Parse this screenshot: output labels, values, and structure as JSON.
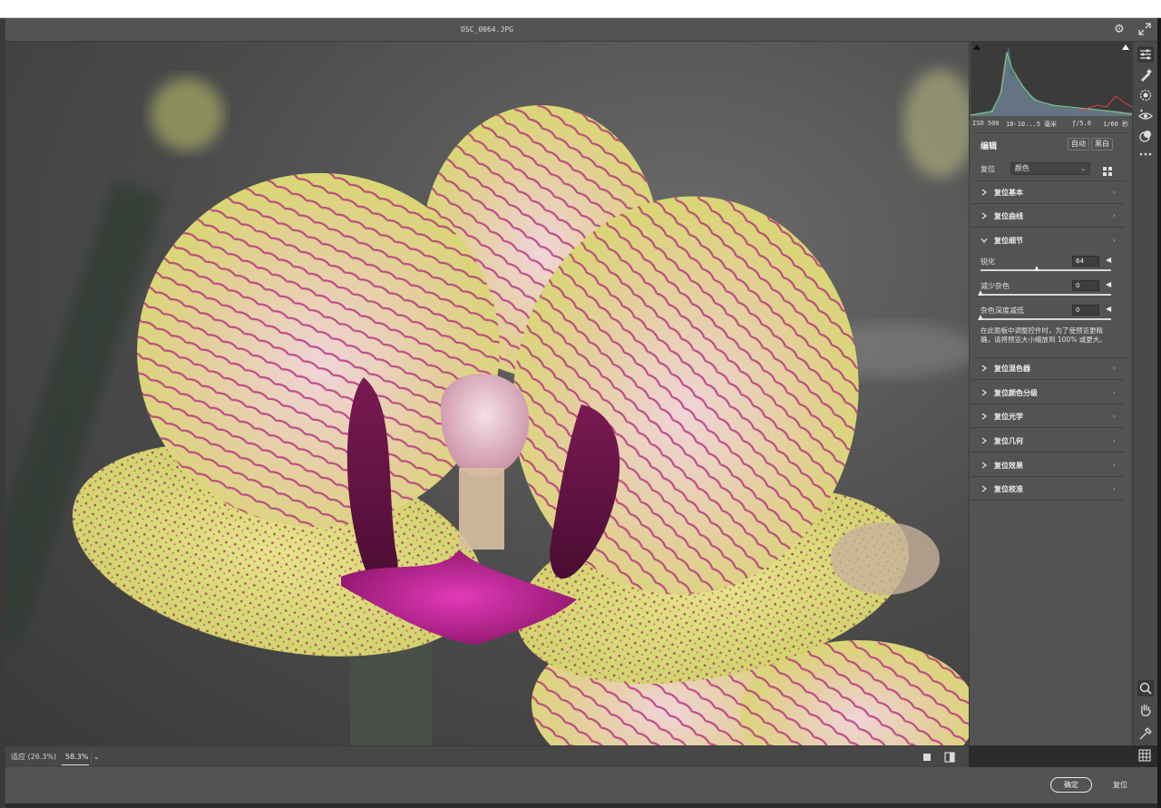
{
  "window": {
    "filename": "DSC_0064.JPG"
  },
  "zoom": {
    "fit_label": "适应 (26.3%)",
    "value": "58.3%",
    "dropdown": "⌄"
  },
  "exif": {
    "iso": "ISO 500",
    "focal": "18-10...5 毫米",
    "aperture": "ƒ/5.6",
    "shutter": "1/60 秒"
  },
  "edit": {
    "title": "编辑",
    "auto_label": "自动",
    "bw_label": "黑白",
    "preset_label": "复位",
    "preset_value": "颜色",
    "preset_dd": "⌄"
  },
  "sections": [
    {
      "label": "复位基本",
      "expanded": false
    },
    {
      "label": "复位曲线",
      "expanded": false
    },
    {
      "label": "复位细节",
      "expanded": true
    },
    {
      "label": "复位混色器",
      "expanded": false
    },
    {
      "label": "复位颜色分级",
      "expanded": false
    },
    {
      "label": "复位光学",
      "expanded": false
    },
    {
      "label": "复位几何",
      "expanded": false
    },
    {
      "label": "复位效果",
      "expanded": false
    },
    {
      "label": "复位校准",
      "expanded": false
    }
  ],
  "detail": {
    "sliders": [
      {
        "label": "锐化",
        "value": "64",
        "level": 0.43
      },
      {
        "label": "减少杂色",
        "value": "0",
        "level": 0.0
      },
      {
        "label": "杂色深度减低",
        "value": "0",
        "level": 0.0
      }
    ],
    "reset_arrow": "◀",
    "note": "在此面板中调整控件时，为了使预览更精确，请将预览大小缩放到 100% 或更大。"
  },
  "section_arrow": "›",
  "footer": {
    "ok_label": "确定",
    "reset_label": "复位"
  },
  "colors": {
    "panel": "#535353",
    "canvas_bg": "#4a4a4a",
    "accent": "#ffffff",
    "petal_vein": "#b0207a",
    "petal_base": "#dfe08c"
  }
}
